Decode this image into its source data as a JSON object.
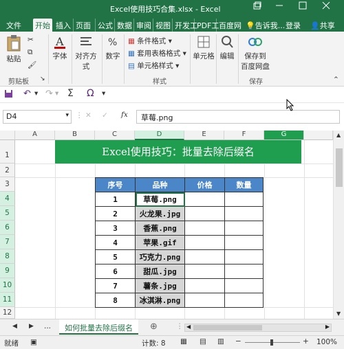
{
  "window": {
    "title": "Excel使用技巧合集.xlsx - Excel",
    "controls": [
      "restore-icon",
      "minimize-icon",
      "maximize-icon",
      "close-icon"
    ]
  },
  "ribbon_tabs": [
    {
      "label": "文件",
      "active": false
    },
    {
      "label": "开始",
      "active": true
    },
    {
      "label": "插入",
      "active": false
    },
    {
      "label": "页面",
      "active": false
    },
    {
      "label": "公式",
      "active": false
    },
    {
      "label": "数据",
      "active": false
    },
    {
      "label": "审阅",
      "active": false
    },
    {
      "label": "视图",
      "active": false
    },
    {
      "label": "开发工",
      "active": false
    },
    {
      "label": "PDF工",
      "active": false
    },
    {
      "label": "百度网",
      "active": false
    }
  ],
  "tell_me": "告诉我...",
  "login": "登录",
  "share": "共享",
  "ribbon": {
    "paste": "粘贴",
    "clipboard_group": "剪贴板",
    "font": "字体",
    "alignment": "对齐方式",
    "number": "数字",
    "conditional_format": "条件格式",
    "table_format": "套用表格格式",
    "cell_style": "单元格样式",
    "styles_group": "样式",
    "cells": "单元格",
    "editing": "编辑",
    "save_to_line1": "保存到",
    "save_to_line2": "百度网盘",
    "save_group": "保存"
  },
  "formula_bar": {
    "name_box": "D4",
    "formula": "草莓.png"
  },
  "columns": [
    "A",
    "B",
    "C",
    "D",
    "E",
    "F",
    "G"
  ],
  "rows": [
    "1",
    "2",
    "3",
    "4",
    "5",
    "6",
    "7",
    "8",
    "9",
    "10",
    "11",
    "12"
  ],
  "banner_title": "Excel使用技巧：批量去除后缀名",
  "table": {
    "headers": [
      "序号",
      "品种",
      "价格",
      "数量"
    ],
    "rows": [
      {
        "no": "1",
        "name": "草莓.png"
      },
      {
        "no": "2",
        "name": "火龙果.jpg"
      },
      {
        "no": "3",
        "name": "香蕉.png"
      },
      {
        "no": "4",
        "name": "苹果.gif"
      },
      {
        "no": "5",
        "name": "巧克力.png"
      },
      {
        "no": "6",
        "name": "甜瓜.jpg"
      },
      {
        "no": "7",
        "name": "薯条.jpg"
      },
      {
        "no": "8",
        "name": "冰淇淋.png"
      }
    ]
  },
  "sheet_tab": "如何批量去除后缀名",
  "sheet_nav_ellipsis": "...",
  "status": {
    "mode": "就绪",
    "count": "计数: 8",
    "zoom": "100%"
  },
  "colors": {
    "accent": "#217346",
    "banner": "#1e9e4e",
    "table_header": "#4a86c8",
    "selected_cell": "#d6d6d6"
  }
}
